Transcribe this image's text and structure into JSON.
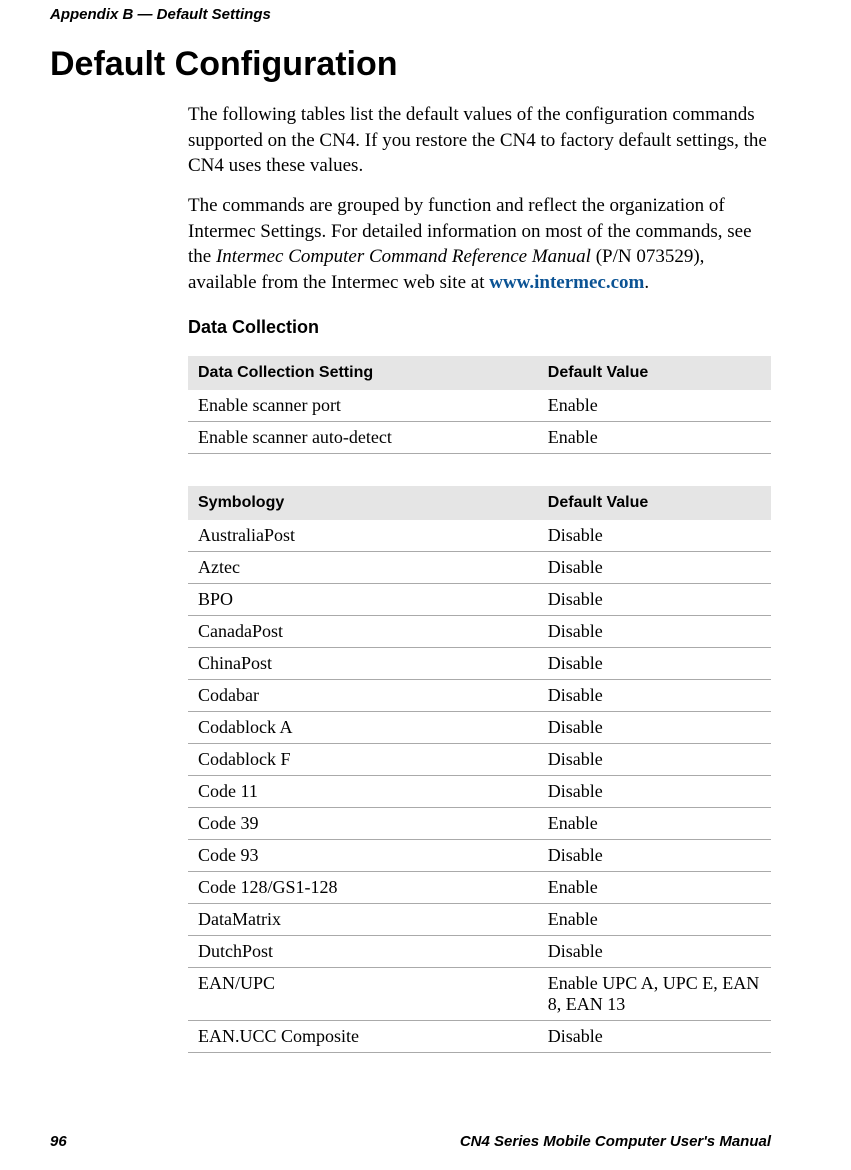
{
  "header": {
    "appendix": "Appendix B — Default Settings"
  },
  "title": "Default Configuration",
  "paragraphs": {
    "p1": "The following tables list the default values of the configuration commands supported on the CN4. If you restore the CN4 to factory default settings, the CN4 uses these values.",
    "p2a": "The commands are grouped by function and reflect the organization of Intermec Settings. For detailed information on most of the commands, see the ",
    "p2_ref": "Intermec Computer Command Reference Manual",
    "p2b": " (P/N 073529), available from the Intermec web site at ",
    "p2_link": "www.intermec.com",
    "p2c": "."
  },
  "section": "Data Collection",
  "table1": {
    "head_setting": "Data Collection Setting",
    "head_value": "Default Value",
    "rows": [
      {
        "setting": "Enable scanner port",
        "value": "Enable"
      },
      {
        "setting": "Enable scanner auto-detect",
        "value": "Enable"
      }
    ]
  },
  "table2": {
    "head_setting": "Symbology",
    "head_value": "Default Value",
    "rows": [
      {
        "setting": "AustraliaPost",
        "value": "Disable"
      },
      {
        "setting": "Aztec",
        "value": "Disable"
      },
      {
        "setting": "BPO",
        "value": "Disable"
      },
      {
        "setting": "CanadaPost",
        "value": "Disable"
      },
      {
        "setting": "ChinaPost",
        "value": "Disable"
      },
      {
        "setting": "Codabar",
        "value": "Disable"
      },
      {
        "setting": "Codablock A",
        "value": "Disable"
      },
      {
        "setting": "Codablock F",
        "value": "Disable"
      },
      {
        "setting": "Code 11",
        "value": "Disable"
      },
      {
        "setting": "Code 39",
        "value": "Enable"
      },
      {
        "setting": "Code 93",
        "value": "Disable"
      },
      {
        "setting": "Code 128/GS1-128",
        "value": "Enable"
      },
      {
        "setting": "DataMatrix",
        "value": "Enable"
      },
      {
        "setting": "DutchPost",
        "value": "Disable"
      },
      {
        "setting": "EAN/UPC",
        "value": "Enable UPC A, UPC E, EAN 8, EAN 13"
      },
      {
        "setting": "EAN.UCC Composite",
        "value": "Disable"
      }
    ]
  },
  "footer": {
    "page": "96",
    "doc": "CN4 Series Mobile Computer User's Manual"
  }
}
